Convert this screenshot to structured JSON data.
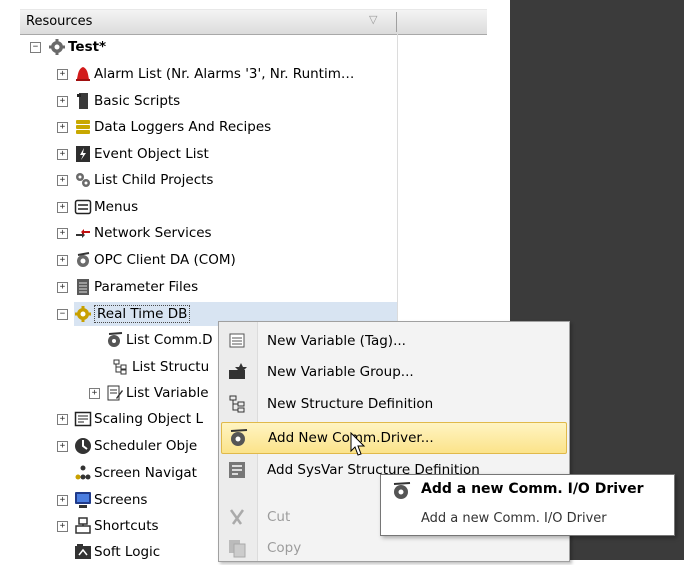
{
  "panel": {
    "header_label": "Resources",
    "header_sort_glyph": "▽"
  },
  "tree": {
    "root_label": "Test*",
    "items": [
      {
        "label": "Alarm List (Nr. Alarms '3', Nr. Runtim…",
        "icon": "alarm-bell-icon"
      },
      {
        "label": "Basic Scripts",
        "icon": "script-icon"
      },
      {
        "label": "Data Loggers And Recipes",
        "icon": "database-icon"
      },
      {
        "label": "Event Object List",
        "icon": "event-icon"
      },
      {
        "label": "List Child Projects",
        "icon": "child-projects-icon"
      },
      {
        "label": "Menus",
        "icon": "menu-icon"
      },
      {
        "label": "Network Services",
        "icon": "network-icon"
      },
      {
        "label": "OPC Client DA (COM)",
        "icon": "opc-icon"
      },
      {
        "label": "Parameter Files",
        "icon": "parameter-file-icon"
      },
      {
        "label": "Real Time DB",
        "icon": "realtime-db-gear-icon"
      },
      {
        "label": "List Comm.D",
        "icon": "comm-driver-icon"
      },
      {
        "label": "List Structu",
        "icon": "structure-icon"
      },
      {
        "label": "List Variable",
        "icon": "variable-list-icon"
      },
      {
        "label": "Scaling Object L",
        "icon": "scaling-icon"
      },
      {
        "label": "Scheduler Obje",
        "icon": "scheduler-icon"
      },
      {
        "label": "Screen Navigat",
        "icon": "screen-navigation-icon"
      },
      {
        "label": "Screens",
        "icon": "screens-icon"
      },
      {
        "label": "Shortcuts",
        "icon": "shortcuts-icon"
      },
      {
        "label": "Soft Logic",
        "icon": "soft-logic-icon"
      }
    ]
  },
  "context_menu": {
    "items": [
      {
        "label": "New Variable (Tag)...",
        "icon": "new-variable-icon"
      },
      {
        "label": "New Variable Group...",
        "icon": "new-group-icon"
      },
      {
        "label": "New Structure Definition",
        "icon": "new-structure-icon"
      },
      {
        "label": "Add New Comm.Driver...",
        "icon": "add-comm-driver-icon"
      },
      {
        "label": "Add SysVar Structure Definition",
        "icon": "sysvar-structure-icon"
      },
      {
        "label": "Cut",
        "icon": "cut-icon"
      },
      {
        "label": "Copy",
        "icon": "copy-icon"
      }
    ]
  },
  "tooltip": {
    "title": "Add a new Comm. I/O Driver",
    "description": "Add a new Comm. I/O Driver"
  },
  "colors": {
    "highlight": "#fbe38a",
    "selection": "#d8e4f2",
    "dark_area": "#3b3b3b"
  }
}
